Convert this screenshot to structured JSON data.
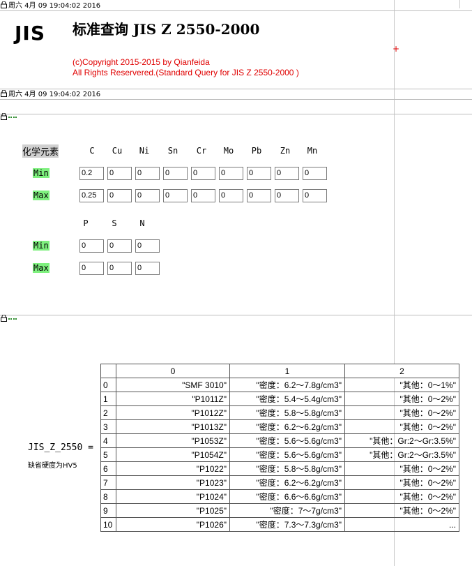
{
  "timestamp1": "周六 4月 09 19:04:02 2016",
  "timestamp2": "周六 4月 09 19:04:02 2016",
  "logo": "JIS",
  "title": "标准查询  JIS Z 2550-2000",
  "copyright_line1": "(c)Copyright 2015-2015 by Qianfeida",
  "copyright_line2": "All Rights Reservered.(Standard Query for JIS Z 2550-2000 )",
  "elements_label": "化学元素",
  "row_min": "Min",
  "row_max": "Max",
  "elements1": [
    "C",
    "Cu",
    "Ni",
    "Sn",
    "Cr",
    "Mo",
    "Pb",
    "Zn",
    "Mn"
  ],
  "min1": [
    "0.2",
    "0",
    "0",
    "0",
    "0",
    "0",
    "0",
    "0",
    "0"
  ],
  "max1": [
    "0.25",
    "0",
    "0",
    "0",
    "0",
    "0",
    "0",
    "0",
    "0"
  ],
  "elements2": [
    "P",
    "S",
    "N"
  ],
  "min2": [
    "0",
    "0",
    "0"
  ],
  "max2": [
    "0",
    "0",
    "0"
  ],
  "result_label": "JIS_Z_2550 =",
  "result_note": "缺省硬度为HV5",
  "table": {
    "headers": [
      "0",
      "1",
      "2"
    ],
    "rows": [
      [
        "0",
        "\"SMF 3010\"",
        "\"密度：6.2～7.8g/cm3\"",
        "\"其他：0～1%\""
      ],
      [
        "1",
        "\"P1011Z\"",
        "\"密度：5.4～5.4g/cm3\"",
        "\"其他：0～2%\""
      ],
      [
        "2",
        "\"P1012Z\"",
        "\"密度：5.8～5.8g/cm3\"",
        "\"其他：0～2%\""
      ],
      [
        "3",
        "\"P1013Z\"",
        "\"密度：6.2～6.2g/cm3\"",
        "\"其他：0～2%\""
      ],
      [
        "4",
        "\"P1053Z\"",
        "\"密度：5.6～5.6g/cm3\"",
        "\"其他：Gr:2～Gr:3.5%\""
      ],
      [
        "5",
        "\"P1054Z\"",
        "\"密度：5.6～5.6g/cm3\"",
        "\"其他：Gr:2～Gr:3.5%\""
      ],
      [
        "6",
        "\"P1022\"",
        "\"密度：5.8～5.8g/cm3\"",
        "\"其他：0～2%\""
      ],
      [
        "7",
        "\"P1023\"",
        "\"密度：6.2～6.2g/cm3\"",
        "\"其他：0～2%\""
      ],
      [
        "8",
        "\"P1024\"",
        "\"密度：6.6～6.6g/cm3\"",
        "\"其他：0～2%\""
      ],
      [
        "9",
        "\"P1025\"",
        "\"密度：7～7g/cm3\"",
        "\"其他：0～2%\""
      ],
      [
        "10",
        "\"P1026\"",
        "\"密度：7.3～7.3g/cm3\"",
        "..."
      ]
    ]
  }
}
